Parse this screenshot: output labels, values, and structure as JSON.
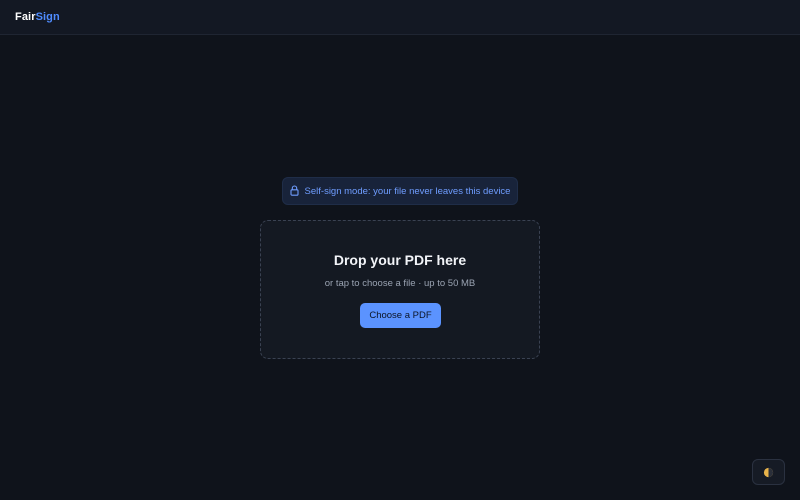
{
  "header": {
    "brand_part1": "Fair",
    "brand_part2": "Sign",
    "brand_color": "#ffffff",
    "accent_color": "#4f8cff"
  },
  "notice": {
    "icon": "lock-icon",
    "text": "Self-sign mode: your file never leaves this device"
  },
  "dropzone": {
    "title": "Drop your PDF here",
    "subtitle": "or tap to choose a file · up to 50 MB",
    "button_label": "Choose a PDF",
    "button_color": "#5b93ff"
  },
  "theme_toggle": {
    "icon": "half-moon-icon"
  }
}
